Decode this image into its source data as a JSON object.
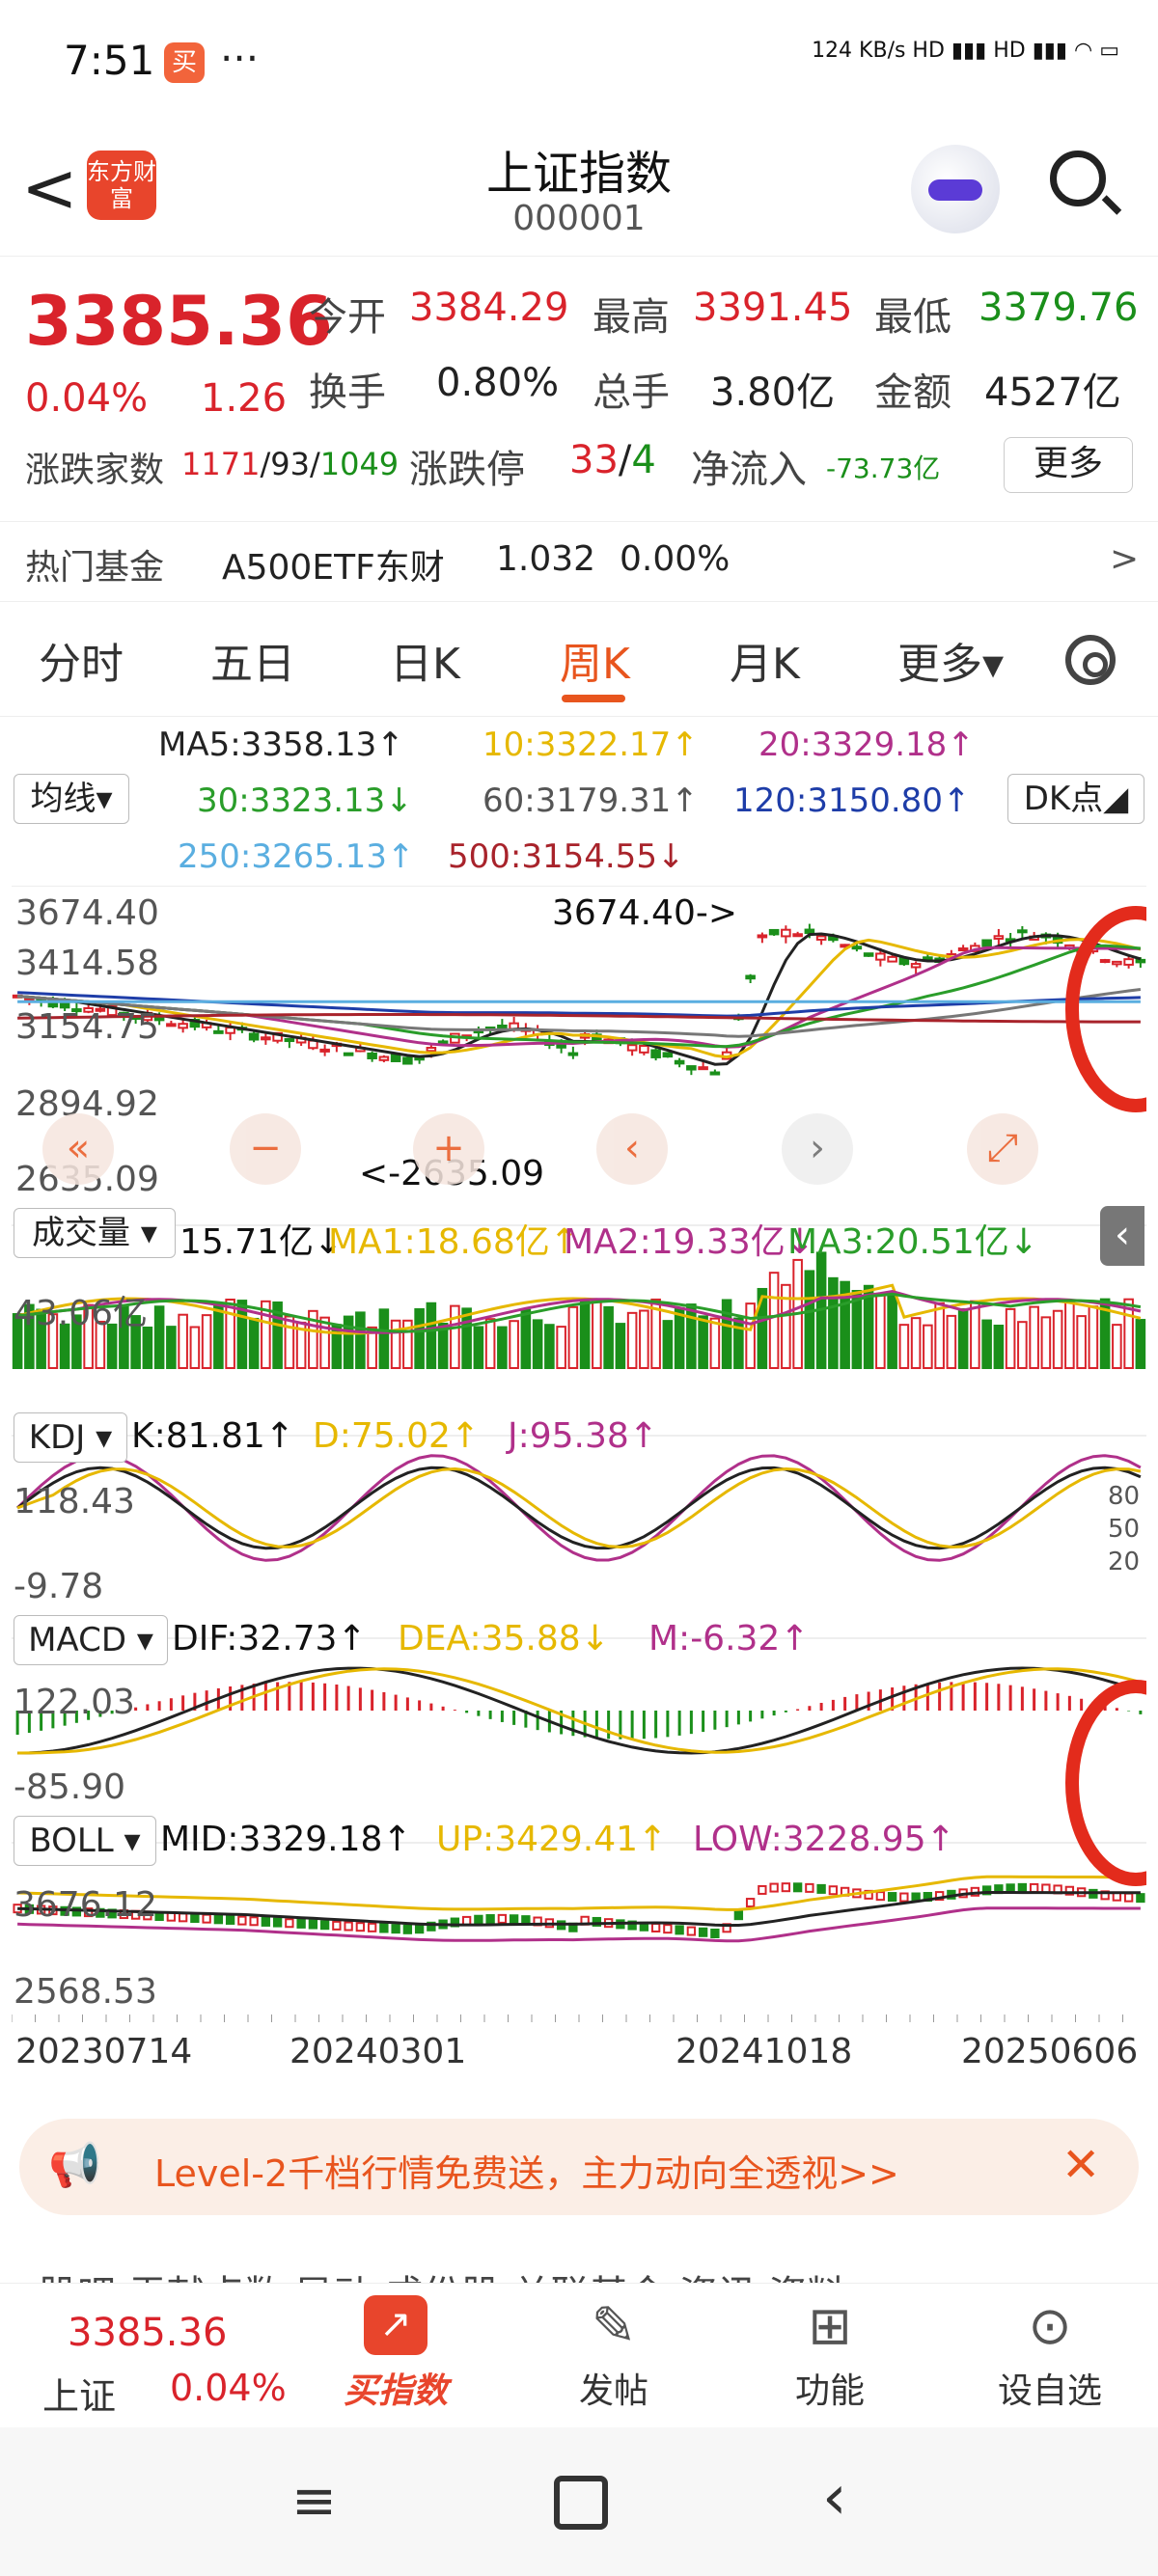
{
  "status_bar": {
    "time": "7:51",
    "app_icon": "买",
    "dots": "···",
    "network": "124 KB/s  HD ▮▮▮ HD ▮▮▮  ◠  ▭"
  },
  "header": {
    "back_label": "<",
    "logo_text": "东方财富",
    "title": "上证指数",
    "code": "000001"
  },
  "quote": {
    "price": "3385.36",
    "change_pct": "0.04%",
    "change": "1.26",
    "open_label": "今开",
    "open": "3384.29",
    "high_label": "最高",
    "high": "3391.45",
    "low_label": "最低",
    "low": "3379.76",
    "turnover_label": "换手",
    "turnover": "0.80%",
    "volume_label": "总手",
    "volume": "3.80亿",
    "amount_label": "金额",
    "amount": "4527亿",
    "breadth_label": "涨跌家数",
    "breadth_up": "1171",
    "breadth_sep": "/93/",
    "breadth_down": "1049",
    "limit_label": "涨跌停",
    "limit_up": "33",
    "limit_sep": "/",
    "limit_down": "4",
    "inflow_label": "净流入",
    "inflow": "-73.73亿",
    "more_label": "更多"
  },
  "hot_fund": {
    "label": "热门基金",
    "name": "A500ETF东财",
    "price": "1.032",
    "pct": "0.00%",
    "arrow": ">"
  },
  "tabs": {
    "items": [
      "分时",
      "五日",
      "日K",
      "周K",
      "月K",
      "更多▾"
    ],
    "active": "周K"
  },
  "ma_legend": {
    "selector": "均线▾",
    "ma5": "MA5:3358.13↑",
    "ma10": "10:3322.17↑",
    "ma20": "20:3329.18↑",
    "ma30": "30:3323.13↓",
    "ma60": "60:3179.31↑",
    "ma120": "120:3150.80↑",
    "ma250": "250:3265.13↑",
    "ma500": "500:3154.55↓",
    "dk": "DK点◢"
  },
  "chart": {
    "axis_top": "3674.40",
    "axis_mid1": "3414.58",
    "axis_mid2": "3154.75",
    "axis_mid3": "2894.92",
    "axis_bottom": "2635.09",
    "max_note": "3674.40->",
    "min_note": "<-2635.09",
    "volume": {
      "selector": "成交量 ▾",
      "value": "15.71亿↓",
      "ma1": "MA1:18.68亿↑",
      "ma2": "MA2:19.33亿↓",
      "ma3": "MA3:20.51亿↓",
      "axis": "43.06亿"
    },
    "kdj": {
      "selector": "KDJ ▾",
      "k": "K:81.81↑",
      "d": "D:75.02↑",
      "j": "J:95.38↑",
      "axis_top": "118.43",
      "axis_bottom": "-9.78",
      "lv80": "80",
      "lv50": "50",
      "lv20": "20"
    },
    "macd": {
      "selector": "MACD ▾",
      "dif": "DIF:32.73↑",
      "dea": "DEA:35.88↓",
      "m": "M:-6.32↑",
      "axis_top": "122.03",
      "axis_bottom": "-85.90"
    },
    "boll": {
      "selector": "BOLL ▾",
      "mid": "MID:3329.18↑",
      "up": "UP:3429.41↑",
      "low": "LOW:3228.95↑",
      "axis_top": "3676.12",
      "axis_bottom": "2568.53"
    },
    "dates": [
      "20230714",
      "20240301",
      "20241018",
      "20250606"
    ]
  },
  "banner": {
    "text": "Level-2千档行情免费送，主力动向全透视>>",
    "close": "✕"
  },
  "sub_tabs": "股吧  贡献点数  异动  成份股  关联基金  资讯  资料",
  "bottom_nav": {
    "index_price": "3385.36",
    "index_name": "上证",
    "index_pct": "0.04%",
    "buy": "买指数",
    "post": "发帖",
    "func": "功能",
    "watch": "设自选"
  },
  "colors": {
    "up": "#d9232b",
    "down": "#1a8f1a",
    "accent": "#e8551e"
  }
}
